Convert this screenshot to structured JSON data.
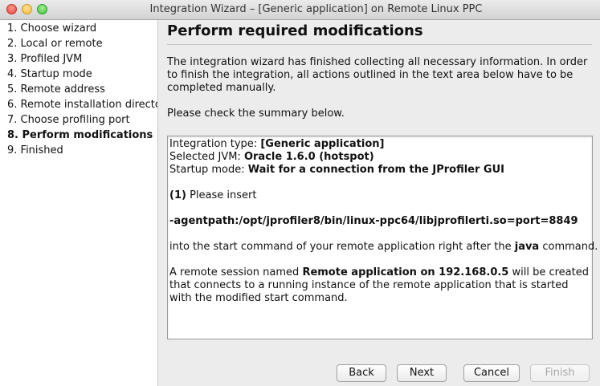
{
  "window": {
    "title": "Integration Wizard – [Generic application] on Remote Linux PPC"
  },
  "steps": [
    {
      "label": "1. Choose wizard"
    },
    {
      "label": "2. Local or remote"
    },
    {
      "label": "3. Profiled JVM"
    },
    {
      "label": "4. Startup mode"
    },
    {
      "label": "5. Remote address"
    },
    {
      "label": "6. Remote installation director"
    },
    {
      "label": "7. Choose profiling port"
    },
    {
      "label": "8. Perform modifications",
      "current": true
    },
    {
      "label": "9. Finished"
    }
  ],
  "main": {
    "heading": "Perform required modifications",
    "intro": "The integration wizard has finished collecting all necessary information. In order to finish the integration, all actions outlined in the text area below have to be completed manually.",
    "check": "Please check the summary below."
  },
  "summary": {
    "integration_type_label": "Integration type: ",
    "integration_type_value": "[Generic application]",
    "jvm_label": "Selected JVM: ",
    "jvm_value": "Oracle 1.6.0 (hotspot)",
    "startup_label": "Startup mode: ",
    "startup_value": "Wait for a connection from the JProfiler GUI",
    "step1_number": "(1)",
    "step1_text": " Please insert",
    "agent_path": "-agentpath:/opt/jprofiler8/bin/linux-ppc64/libjprofilerti.so=port=8849",
    "into_before": "into the start command of your remote application right after the ",
    "into_bold": "java",
    "into_after": " command.",
    "session_before": "A remote session named ",
    "session_bold": "Remote application on 192.168.0.5",
    "session_after": " will be created that connects to a running instance of the remote application that is started with the modified start command."
  },
  "buttons": {
    "back": "Back",
    "next": "Next",
    "cancel": "Cancel",
    "finish": "Finish"
  }
}
